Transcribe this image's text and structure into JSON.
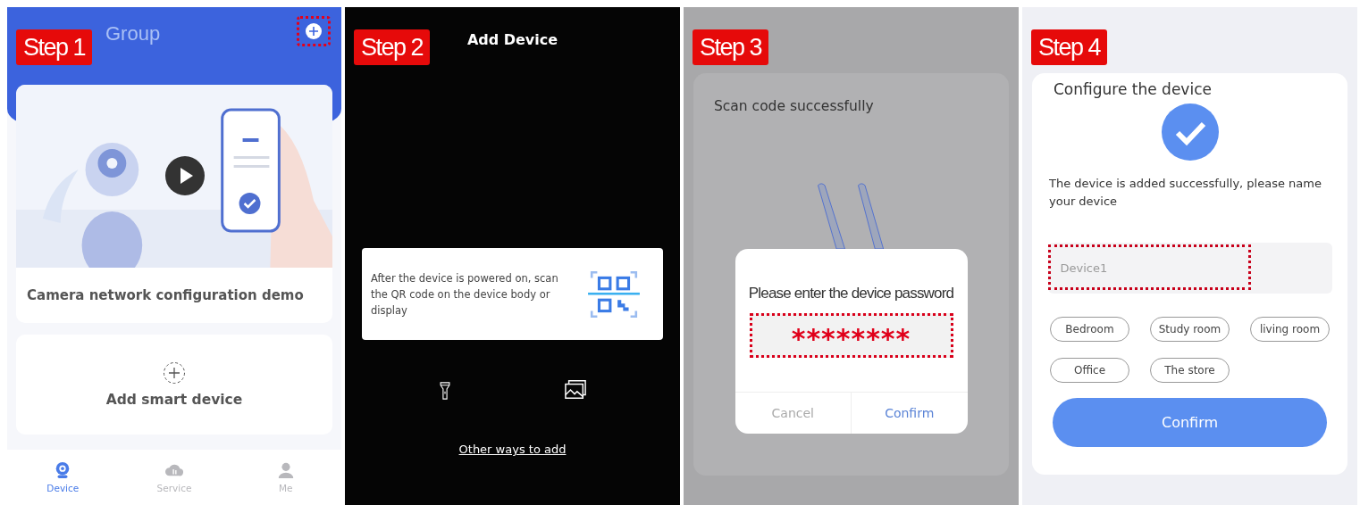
{
  "device_home": {
    "step_badge": "Step 1",
    "tabs": [
      {
        "label": "Group",
        "selected": false
      }
    ],
    "demo_card": {
      "caption": "Camera network configuration demo"
    },
    "add_card": {
      "label": "Add smart device"
    },
    "nav": [
      {
        "label": "Device",
        "kind": "camera",
        "selected": true
      },
      {
        "label": "Service",
        "kind": "cloud",
        "selected": false
      },
      {
        "label": "Me",
        "kind": "person",
        "selected": false
      }
    ]
  },
  "scanner": {
    "step_badge": "Step 2",
    "title": "Add Device",
    "hint": "After the device is powered on, scan the QR code on the device body or display",
    "link": "Other ways to add"
  },
  "password_dialog": {
    "step_badge": "Step 3",
    "title": "Scan code successfully",
    "prompt": "Please enter the device password",
    "password": "********",
    "buttons": [
      "Cancel",
      "Confirm"
    ]
  },
  "name_device": {
    "step_badge": "Step 4",
    "title": "Configure the device",
    "message": "The device is added successfully, please name your device",
    "placeholder": "Device1",
    "chips": [
      "Bedroom",
      "Study room",
      "living room",
      "Office",
      "The store"
    ],
    "confirm": "Confirm"
  }
}
